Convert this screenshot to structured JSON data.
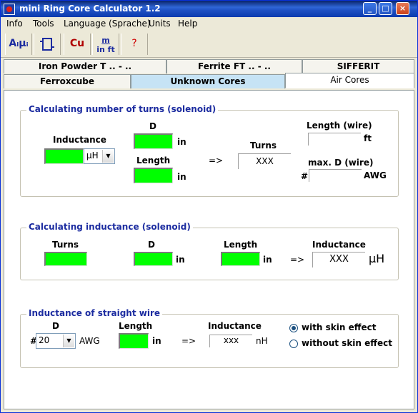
{
  "window": {
    "title": "mini Ring Core Calculator 1.2"
  },
  "menu": [
    "Info",
    "Tools",
    "Language (Sprache)",
    "Units",
    "Help"
  ],
  "toolbar": {
    "tool1": "Aₗμᵢ",
    "tool3": "Cu",
    "tool4_top": "m",
    "tool4_bottom": "in ft",
    "tool5": "?"
  },
  "tabs": {
    "row1": [
      "Iron Powder T .. - ..",
      "Ferrite FT .. - ..",
      "SIFFERIT"
    ],
    "row2": [
      "Ferroxcube",
      "Unknown Cores",
      "Air Cores"
    ]
  },
  "turns_group": {
    "title": "Calculating number of turns (solenoid)",
    "inductance_label": "Inductance",
    "unit_select": "µH",
    "d_label": "D",
    "length_label": "Length",
    "in1": "in",
    "in2": "in",
    "arrow": "=>",
    "turns_label": "Turns",
    "turns_value": "XXX",
    "wire_length_label": "Length (wire)",
    "ft": "ft",
    "maxd_label": "max. D (wire)",
    "hash": "#",
    "awg": "AWG"
  },
  "induct_group": {
    "title": "Calculating inductance (solenoid)",
    "turns_label": "Turns",
    "d_label": "D",
    "length_label": "Length",
    "in1": "in",
    "in2": "in",
    "arrow": "=>",
    "inductance_label": "Inductance",
    "value": "XXX",
    "unit": "µH"
  },
  "wire_group": {
    "title": "Inductance of straight wire",
    "d_label": "D",
    "hash": "#",
    "awg_select": "20",
    "awg": "AWG",
    "length_label": "Length",
    "in": "in",
    "arrow": "=>",
    "inductance_label": "Inductance",
    "value": "xxx",
    "unit": "nH",
    "radio_with": "with skin effect",
    "radio_without": "without skin effect"
  }
}
